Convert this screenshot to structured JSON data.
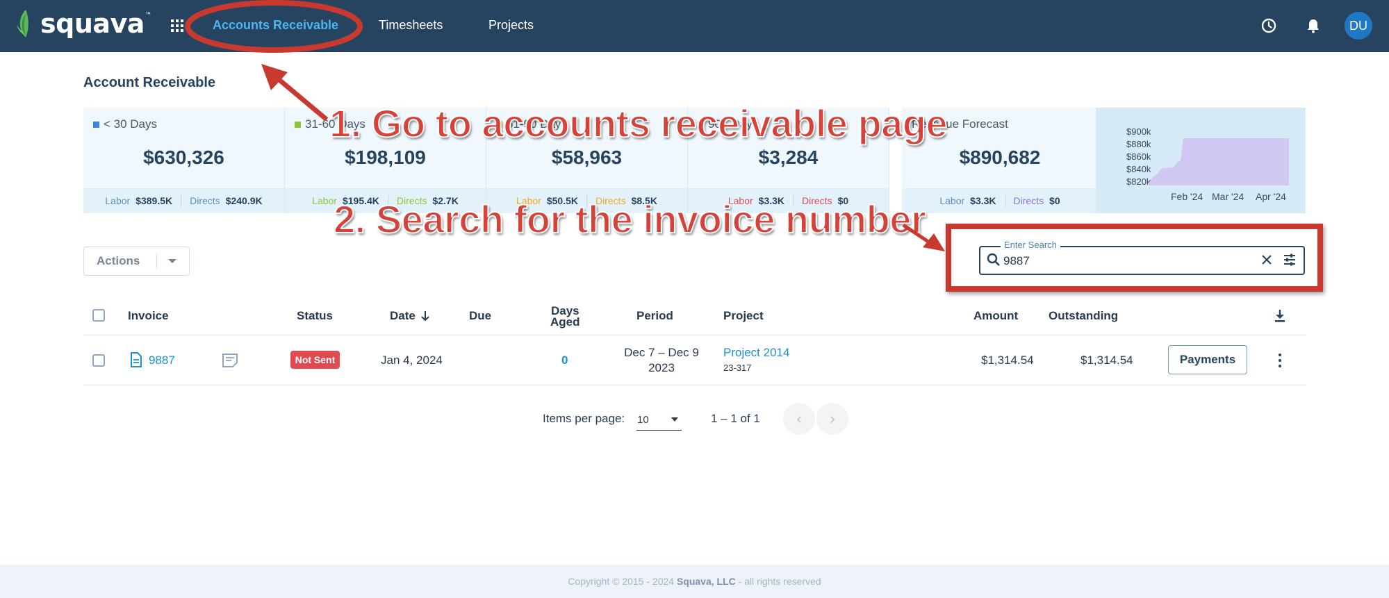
{
  "header": {
    "brand": "squava",
    "nav": [
      {
        "label": "Accounts Receivable",
        "active": true
      },
      {
        "label": "Timesheets"
      },
      {
        "label": "Projects"
      }
    ],
    "avatar_initials": "DU"
  },
  "page_title": "Account Receivable",
  "summary_cards": [
    {
      "label": "< 30 Days",
      "color": "#3f86d9",
      "value": "$630,326",
      "labor_label": "Labor",
      "labor": "$389.5K",
      "directs_label": "Directs",
      "directs": "$240.9K"
    },
    {
      "label": "31-60 Days",
      "color": "#8cc63f",
      "value": "$198,109",
      "labor_label": "Labor",
      "labor": "$195.4K",
      "directs_label": "Directs",
      "directs": "$2.7K"
    },
    {
      "label": "61-90 Days",
      "color": "#f5a623",
      "value": "$58,963",
      "labor_label": "Labor",
      "labor": "$50.5K",
      "directs_label": "Directs",
      "directs": "$8.5K"
    },
    {
      "label": "90+ Days",
      "color": "#e24a52",
      "value": "$3,284",
      "labor_label": "Labor",
      "labor": "$3.3K",
      "directs_label": "Directs",
      "directs": "$0"
    }
  ],
  "forecast": {
    "label": "Revenue Forecast",
    "value": "$890,682",
    "labor_label": "Labor",
    "labor": "$3.3K",
    "directs_label": "Directs",
    "directs": "$0",
    "chart_data": {
      "type": "area",
      "x": [
        "Feb '24",
        "Mar '24",
        "Apr '24"
      ],
      "y_ticks": [
        "$900k",
        "$880k",
        "$860k",
        "$840k",
        "$820k"
      ],
      "ylim": [
        820000,
        900000
      ],
      "series_color": "#d0c8f2"
    }
  },
  "annotations": {
    "step1": "1. Go to accounts receivable page",
    "step2": "2. Search for the invoice number"
  },
  "toolbar": {
    "actions_label": "Actions",
    "search_legend": "Enter Search",
    "search_value": "9887"
  },
  "table": {
    "columns": {
      "invoice": "Invoice",
      "status": "Status",
      "date": "Date",
      "due": "Due",
      "days_aged_1": "Days",
      "days_aged_2": "Aged",
      "period": "Period",
      "project": "Project",
      "amount": "Amount",
      "outstanding": "Outstanding"
    },
    "rows": [
      {
        "invoice": "9887",
        "status": "Not Sent",
        "date": "Jan 4, 2024",
        "due": "",
        "days_aged": "0",
        "period_line1": "Dec 7 – Dec 9",
        "period_line2": "2023",
        "project": "Project 2014",
        "project_code": "23-317",
        "amount": "$1,314.54",
        "outstanding": "$1,314.54",
        "action_label": "Payments"
      }
    ]
  },
  "pagination": {
    "items_per_page_label": "Items per page:",
    "items_per_page": "10",
    "range": "1 – 1 of 1"
  },
  "footer": {
    "prefix": "Copyright © 2015 - 2024",
    "company": "Squava, LLC",
    "suffix": "- all rights reserved"
  }
}
